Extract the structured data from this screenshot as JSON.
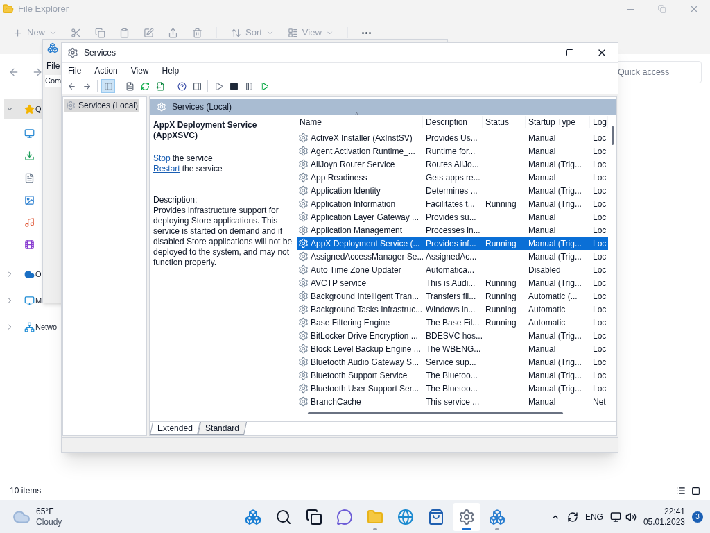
{
  "explorer": {
    "title": "File Explorer",
    "toolbar": [
      {
        "kind": "new",
        "label": "New"
      },
      {
        "kind": "cut"
      },
      {
        "kind": "copy"
      },
      {
        "kind": "paste"
      },
      {
        "kind": "rename"
      },
      {
        "kind": "share"
      },
      {
        "kind": "delete"
      },
      {
        "kind": "sort",
        "label": "Sort"
      },
      {
        "kind": "view",
        "label": "View"
      },
      {
        "kind": "more"
      }
    ],
    "search": {
      "placeholder": "Quick access"
    },
    "sidebar": [
      {
        "kind": "star",
        "label": "Q",
        "expanded": true,
        "selected": true,
        "children": [
          {
            "kind": "desktop",
            "selected": false
          },
          {
            "kind": "download",
            "selected": false
          },
          {
            "kind": "document",
            "selected": false
          },
          {
            "kind": "pictures",
            "selected": false
          },
          {
            "kind": "music",
            "selected": false
          },
          {
            "kind": "video",
            "selected": false
          }
        ]
      },
      {
        "kind": "cloud",
        "label": "O",
        "expanded": false,
        "selected": false
      },
      {
        "kind": "computer",
        "label": "M",
        "expanded": false,
        "selected": false
      },
      {
        "kind": "network",
        "label": "Netwo",
        "expanded": false,
        "selected": false
      }
    ],
    "status": "10 items"
  },
  "computer_management": {
    "menu_item": "File",
    "tree_item": "Com"
  },
  "services": {
    "title": "Services",
    "menu": [
      "File",
      "Action",
      "View",
      "Help"
    ],
    "toolbar": [
      {
        "kind": "back",
        "pressed": false
      },
      {
        "kind": "forward",
        "pressed": false
      },
      {
        "kind": "tree",
        "pressed": true
      },
      {
        "kind": "properties",
        "pressed": false
      },
      {
        "kind": "refresh",
        "pressed": false
      },
      {
        "kind": "export",
        "pressed": false
      },
      {
        "kind": "help",
        "pressed": false
      },
      {
        "kind": "action-pane",
        "pressed": false
      },
      {
        "kind": "start",
        "pressed": false
      },
      {
        "kind": "stop",
        "pressed": false
      },
      {
        "kind": "pause",
        "pressed": false
      },
      {
        "kind": "resume",
        "pressed": false
      }
    ],
    "tree": [
      {
        "label": "Services (Local)",
        "selected": true
      }
    ],
    "header": "Services (Local)",
    "detail": {
      "title": "AppX Deployment Service (AppXSVC)",
      "actions": [
        {
          "link": "Stop",
          "text": "the service"
        },
        {
          "link": "Restart",
          "text": "the service"
        }
      ],
      "description_label": "Description:",
      "description": "Provides infrastructure support for deploying Store applications. This service is started on demand and if disabled Store applications will not be deployed to the system, and may not function properly."
    },
    "table": {
      "sort_indicator": "^",
      "columns": [
        "Name",
        "Description",
        "Status",
        "Startup Type",
        "Log"
      ],
      "rows": [
        {
          "cells": [
            "ActiveX Installer (AxInstSV)",
            "Provides Us...",
            "",
            "Manual",
            "Loc"
          ],
          "selected": false
        },
        {
          "cells": [
            "Agent Activation Runtime_...",
            "Runtime for...",
            "",
            "Manual",
            "Loc"
          ],
          "selected": false
        },
        {
          "cells": [
            "AllJoyn Router Service",
            "Routes AllJo...",
            "",
            "Manual (Trig...",
            "Loc"
          ],
          "selected": false
        },
        {
          "cells": [
            "App Readiness",
            "Gets apps re...",
            "",
            "Manual",
            "Loc"
          ],
          "selected": false
        },
        {
          "cells": [
            "Application Identity",
            "Determines ...",
            "",
            "Manual (Trig...",
            "Loc"
          ],
          "selected": false
        },
        {
          "cells": [
            "Application Information",
            "Facilitates t...",
            "Running",
            "Manual (Trig...",
            "Loc"
          ],
          "selected": false
        },
        {
          "cells": [
            "Application Layer Gateway ...",
            "Provides su...",
            "",
            "Manual",
            "Loc"
          ],
          "selected": false
        },
        {
          "cells": [
            "Application Management",
            "Processes in...",
            "",
            "Manual",
            "Loc"
          ],
          "selected": false
        },
        {
          "cells": [
            "AppX Deployment Service (...",
            "Provides inf...",
            "Running",
            "Manual (Trig...",
            "Loc"
          ],
          "selected": true
        },
        {
          "cells": [
            "AssignedAccessManager Se...",
            "AssignedAc...",
            "",
            "Manual (Trig...",
            "Loc"
          ],
          "selected": false
        },
        {
          "cells": [
            "Auto Time Zone Updater",
            "Automatica...",
            "",
            "Disabled",
            "Loc"
          ],
          "selected": false
        },
        {
          "cells": [
            "AVCTP service",
            "This is Audi...",
            "Running",
            "Manual (Trig...",
            "Loc"
          ],
          "selected": false
        },
        {
          "cells": [
            "Background Intelligent Tran...",
            "Transfers fil...",
            "Running",
            "Automatic (...",
            "Loc"
          ],
          "selected": false
        },
        {
          "cells": [
            "Background Tasks Infrastruc...",
            "Windows in...",
            "Running",
            "Automatic",
            "Loc"
          ],
          "selected": false
        },
        {
          "cells": [
            "Base Filtering Engine",
            "The Base Fil...",
            "Running",
            "Automatic",
            "Loc"
          ],
          "selected": false
        },
        {
          "cells": [
            "BitLocker Drive Encryption ...",
            "BDESVC hos...",
            "",
            "Manual (Trig...",
            "Loc"
          ],
          "selected": false
        },
        {
          "cells": [
            "Block Level Backup Engine ...",
            "The WBENG...",
            "",
            "Manual",
            "Loc"
          ],
          "selected": false
        },
        {
          "cells": [
            "Bluetooth Audio Gateway S...",
            "Service sup...",
            "",
            "Manual (Trig...",
            "Loc"
          ],
          "selected": false
        },
        {
          "cells": [
            "Bluetooth Support Service",
            "The Bluetoo...",
            "",
            "Manual (Trig...",
            "Loc"
          ],
          "selected": false
        },
        {
          "cells": [
            "Bluetooth User Support Ser...",
            "The Bluetoo...",
            "",
            "Manual (Trig...",
            "Loc"
          ],
          "selected": false
        },
        {
          "cells": [
            "BranchCache",
            "This service ...",
            "",
            "Manual",
            "Net"
          ],
          "selected": false
        }
      ]
    },
    "tabs": [
      {
        "label": "Extended",
        "selected": true
      },
      {
        "label": "Standard",
        "selected": false
      }
    ]
  },
  "taskbar": {
    "weather": {
      "temperature": "65°F",
      "condition": "Cloudy"
    },
    "apps": [
      {
        "kind": "start",
        "active": false,
        "running": false
      },
      {
        "kind": "search",
        "active": false,
        "running": false
      },
      {
        "kind": "task-view",
        "active": false,
        "running": false
      },
      {
        "kind": "chat",
        "active": false,
        "running": false
      },
      {
        "kind": "explorer",
        "active": false,
        "running": true
      },
      {
        "kind": "edge",
        "active": false,
        "running": false
      },
      {
        "kind": "store",
        "active": false,
        "running": false
      },
      {
        "kind": "services",
        "active": true,
        "running": true
      },
      {
        "kind": "management",
        "active": false,
        "running": true
      }
    ],
    "language": "ENG",
    "time": "22:41",
    "date": "05.01.2023",
    "notifications": "3"
  }
}
